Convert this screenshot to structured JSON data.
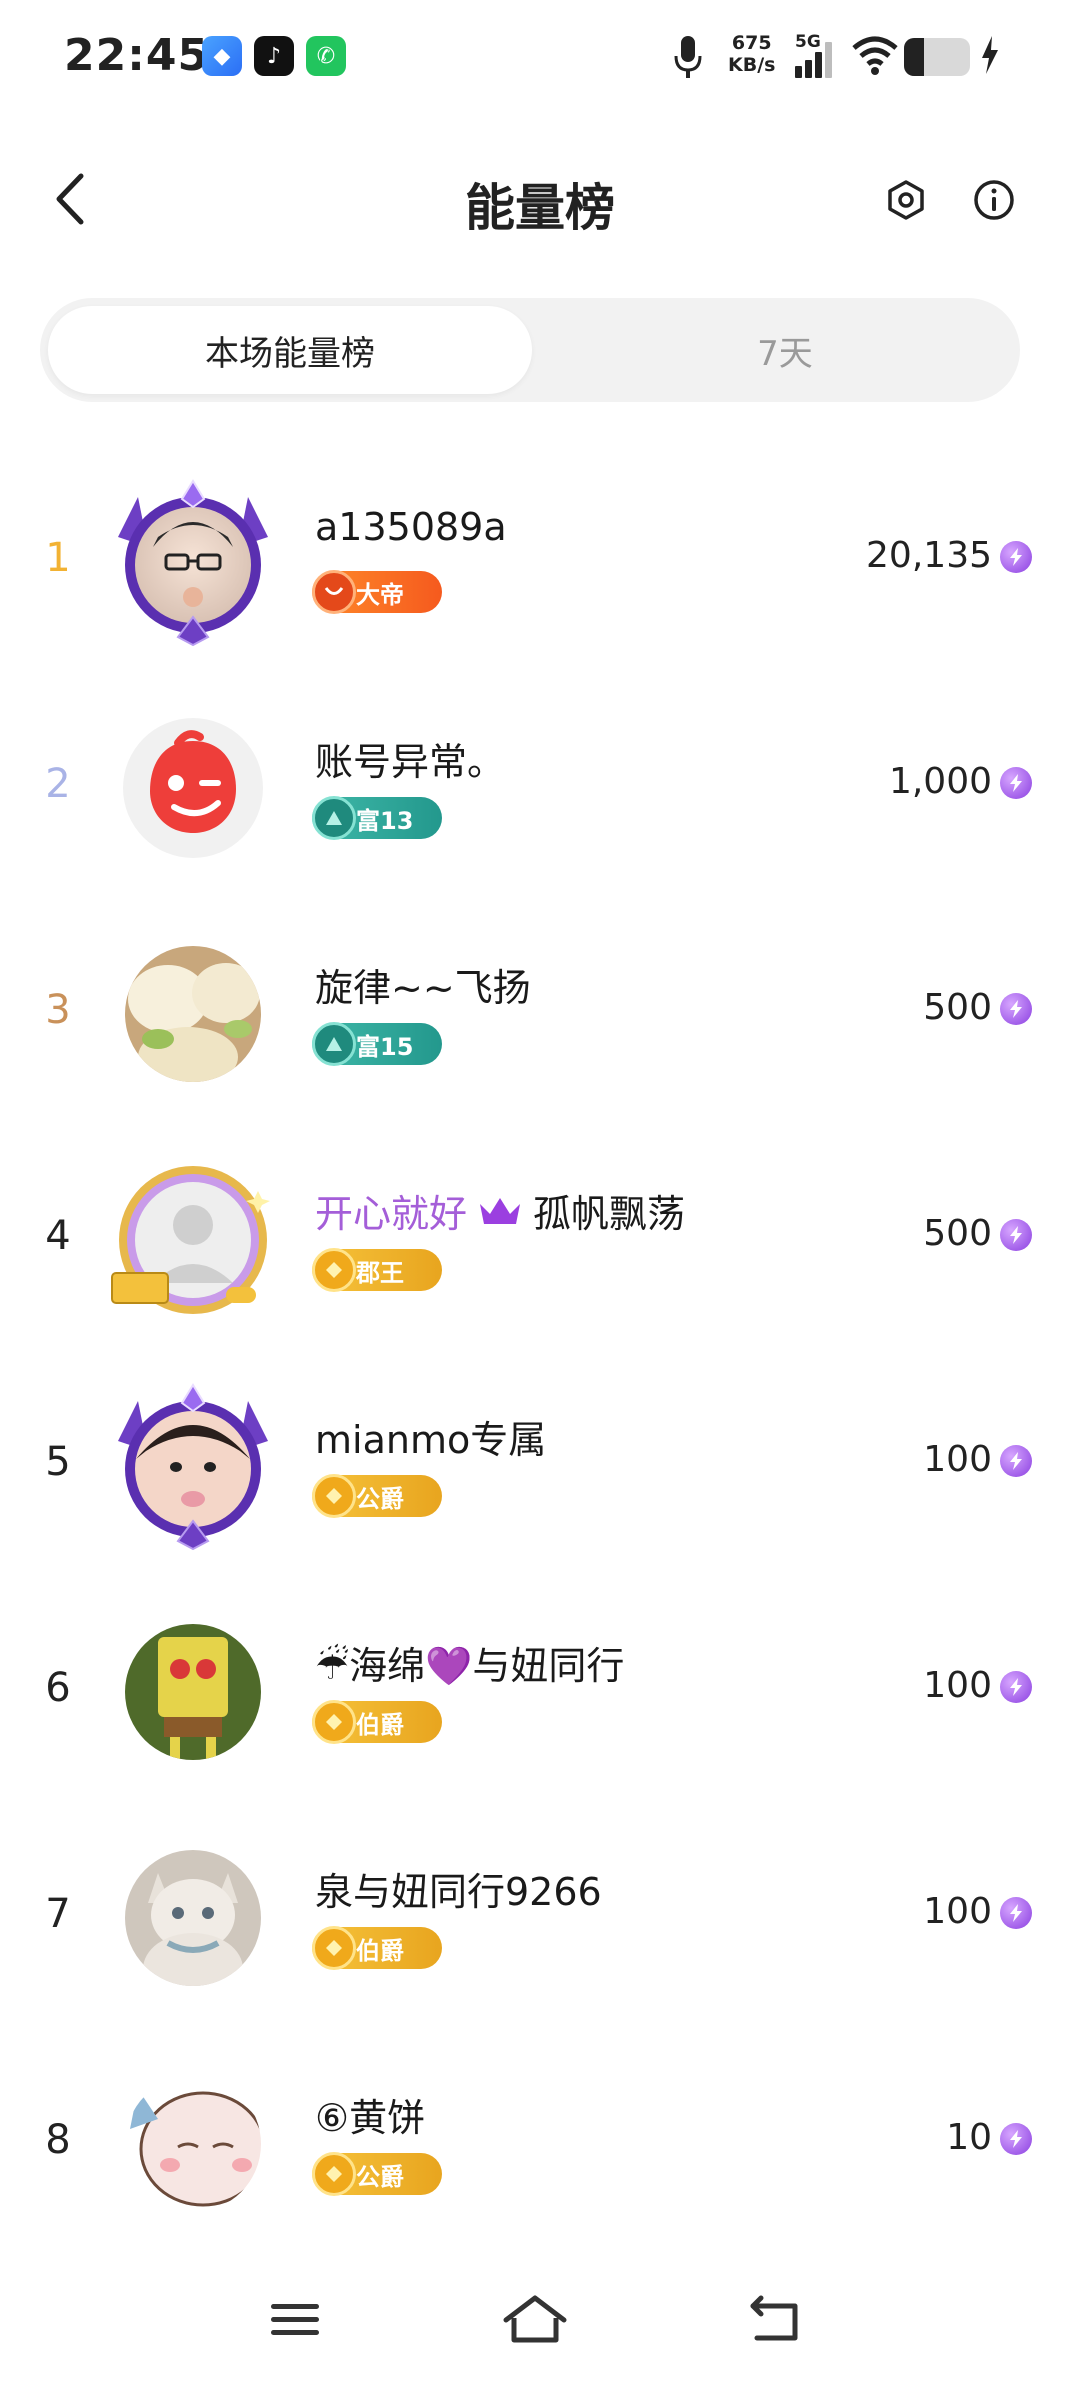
{
  "status_bar": {
    "time": "22:45",
    "net_speed_value": "675",
    "net_speed_unit": "KB/s",
    "network": "5G",
    "battery_percent": 30
  },
  "header": {
    "title": "能量榜"
  },
  "tabs": [
    {
      "label": "本场能量榜",
      "active": true
    },
    {
      "label": "7天",
      "active": false
    }
  ],
  "ranking": [
    {
      "rank": "1",
      "name": "a135089a",
      "badge": "大帝",
      "badge_style": "orange",
      "score": "20,135",
      "avatar": "purple-crown-frame"
    },
    {
      "rank": "2",
      "name": "账号异常。",
      "badge": "富13",
      "badge_style": "teal",
      "score": "1,000",
      "avatar": "red-wink-face"
    },
    {
      "rank": "3",
      "name": "旋律~~飞扬",
      "badge": "富15",
      "badge_style": "teal",
      "score": "500",
      "avatar": "ice-cream-photo"
    },
    {
      "rank": "4",
      "name_prefix": "开心就好",
      "name": "孤帆飘荡",
      "badge": "郡王",
      "badge_style": "gold",
      "score": "500",
      "avatar": "default-gold-frame"
    },
    {
      "rank": "5",
      "name": "mianmo专属",
      "badge": "公爵",
      "badge_style": "gold",
      "score": "100",
      "avatar": "purple-crown-frame"
    },
    {
      "rank": "6",
      "name": "☔海绵💜与妞同行",
      "badge": "伯爵",
      "badge_style": "gold",
      "score": "100",
      "avatar": "sponge-photo"
    },
    {
      "rank": "7",
      "name": "泉与妞同行9266",
      "badge": "伯爵",
      "badge_style": "gold",
      "score": "100",
      "avatar": "cat-photo"
    },
    {
      "rank": "8",
      "name": "⑥黄饼",
      "badge": "公爵",
      "badge_style": "gold",
      "score": "10",
      "avatar": "cartoon-face"
    }
  ],
  "icons": {
    "accent": "#8a3fe0"
  }
}
